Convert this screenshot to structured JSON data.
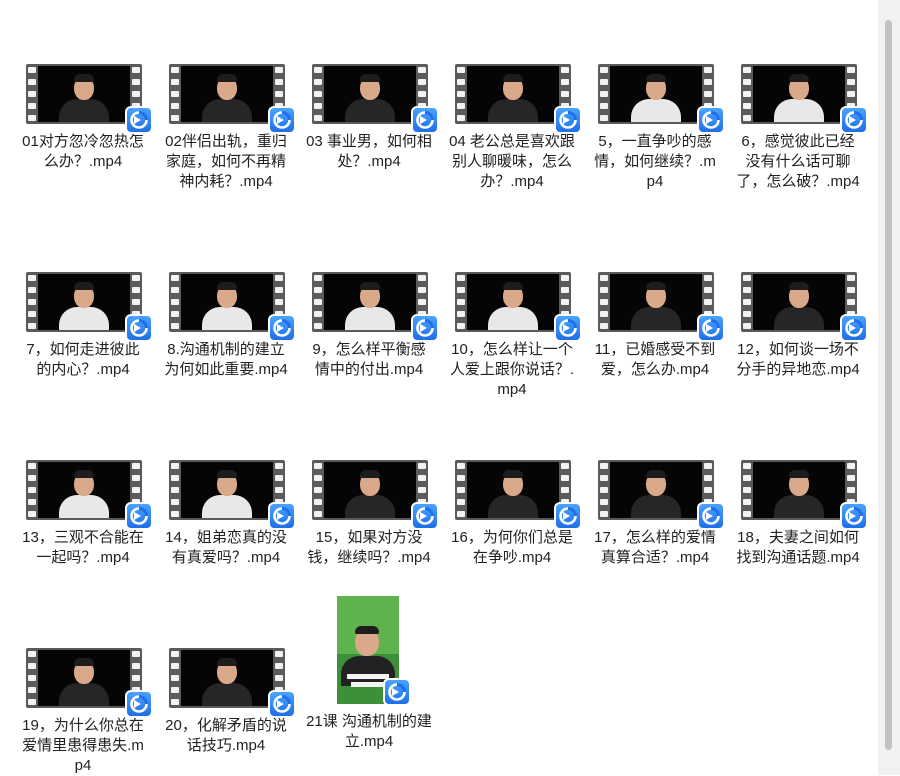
{
  "files": [
    {
      "name": "01对方忽冷忽热怎么办？.mp4",
      "torso": "dark"
    },
    {
      "name": "02伴侣出轨，重归家庭，如何不再精神内耗？.mp4",
      "torso": "dark"
    },
    {
      "name": "03 事业男，如何相处？.mp4",
      "torso": "dark"
    },
    {
      "name": "04 老公总是喜欢跟别人聊暖味，怎么办？.mp4",
      "torso": "dark"
    },
    {
      "name": "5，一直争吵的感情，如何继续？.mp4",
      "torso": "white"
    },
    {
      "name": "6，感觉彼此已经没有什么话可聊了，怎么破？.mp4",
      "torso": "white"
    },
    {
      "name": "7，如何走进彼此的内心？.mp4",
      "torso": "white"
    },
    {
      "name": "8.沟通机制的建立为何如此重要.mp4",
      "torso": "white"
    },
    {
      "name": "9，怎么样平衡感情中的付出.mp4",
      "torso": "white"
    },
    {
      "name": "10，怎么样让一个人爱上跟你说话？.mp4",
      "torso": "white"
    },
    {
      "name": "11，已婚感受不到爱，怎么办.mp4",
      "torso": "dark"
    },
    {
      "name": "12，如何谈一场不分手的异地恋.mp4",
      "torso": "dark"
    },
    {
      "name": "13，三观不合能在一起吗？.mp4",
      "torso": "white"
    },
    {
      "name": "14，姐弟恋真的没有真爱吗？.mp4",
      "torso": "white"
    },
    {
      "name": "15，如果对方没钱，继续吗？.mp4",
      "torso": "dark"
    },
    {
      "name": "16，为何你们总是在争吵.mp4",
      "torso": "dark"
    },
    {
      "name": "17，怎么样的爱情真算合适？.mp4",
      "torso": "dark"
    },
    {
      "name": "18，夫妻之间如何找到沟通话题.mp4",
      "torso": "dark"
    },
    {
      "name": "19，为什么你总在爱情里患得患失.mp4",
      "torso": "dark"
    },
    {
      "name": "20，化解矛盾的说话技巧.mp4",
      "torso": "dark"
    },
    {
      "name": "21课 沟通机制的建立.mp4",
      "torso": "vertical"
    }
  ]
}
